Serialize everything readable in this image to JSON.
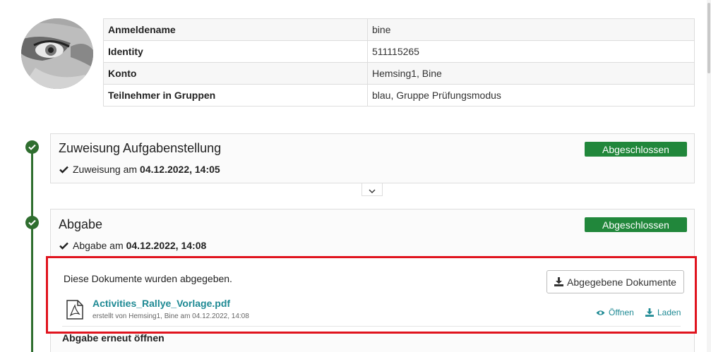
{
  "user_info": {
    "rows": [
      {
        "label": "Anmeldename",
        "value": "bine"
      },
      {
        "label": "Identity",
        "value": "511115265"
      },
      {
        "label": "Konto",
        "value": "Hemsing1, Bine"
      },
      {
        "label": "Teilnehmer in Gruppen",
        "value": "blau, Gruppe Prüfungsmodus"
      }
    ]
  },
  "assignment": {
    "title": "Zuweisung Aufgabenstellung",
    "status": "Abgeschlossen",
    "meta_prefix": "Zuweisung am",
    "meta_date": "04.12.2022, 14:05"
  },
  "submission": {
    "title": "Abgabe",
    "status": "Abgeschlossen",
    "meta_prefix": "Abgabe am",
    "meta_date": "04.12.2022, 14:08",
    "docs_text": "Diese Dokumente wurden abgegeben.",
    "docs_button": "Abgegebene Dokumente",
    "file_name": "Activities_Rallye_Vorlage.pdf",
    "file_meta": "erstellt von Hemsing1, Bine am 04.12.2022, 14:08",
    "open_label": "Öffnen",
    "download_label": "Laden",
    "reopen_label": "Abgabe erneut öffnen"
  },
  "colors": {
    "timeline": "#2f6e2f",
    "badge": "#21873b",
    "link": "#1f8a94",
    "highlight": "#e0141e"
  }
}
